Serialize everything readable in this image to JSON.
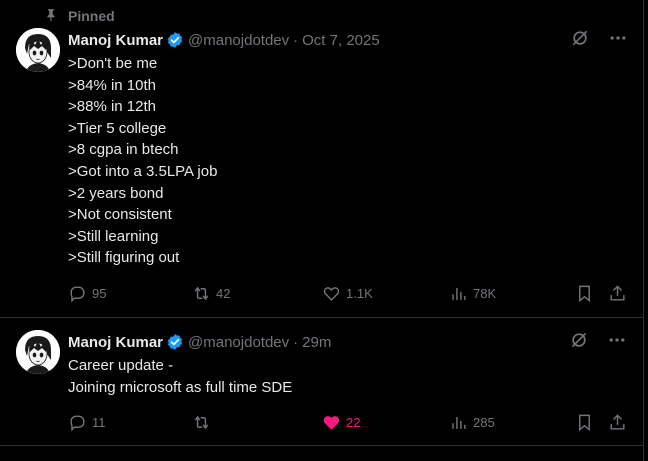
{
  "pinned_label": "Pinned",
  "colors": {
    "background": "#000000",
    "text": "#e7e9ea",
    "muted": "#71767b",
    "verified": "#1d9bf0",
    "like": "#f91880"
  },
  "posts": [
    {
      "author": {
        "name": "Manoj Kumar",
        "handle": "@manojdotdev",
        "verified": true
      },
      "timestamp": "Oct 7, 2025",
      "lines": [
        ">Don't be me",
        ">84% in 10th",
        ">88% in 12th",
        ">Tier 5 college",
        ">8 cgpa in btech",
        ">Got into a 3.5LPA job",
        ">2 years bond",
        ">Not consistent",
        ">Still learning",
        ">Still figuring out"
      ],
      "stats": {
        "replies": "95",
        "reposts": "42",
        "likes": "1.1K",
        "views": "78K"
      },
      "liked": false
    },
    {
      "author": {
        "name": "Manoj Kumar",
        "handle": "@manojdotdev",
        "verified": true
      },
      "timestamp": "29m",
      "lines": [
        "Career update -",
        "Joining rnicrosoft as full time SDE"
      ],
      "stats": {
        "replies": "11",
        "reposts": "",
        "likes": "22",
        "views": "285"
      },
      "liked": true
    }
  ]
}
